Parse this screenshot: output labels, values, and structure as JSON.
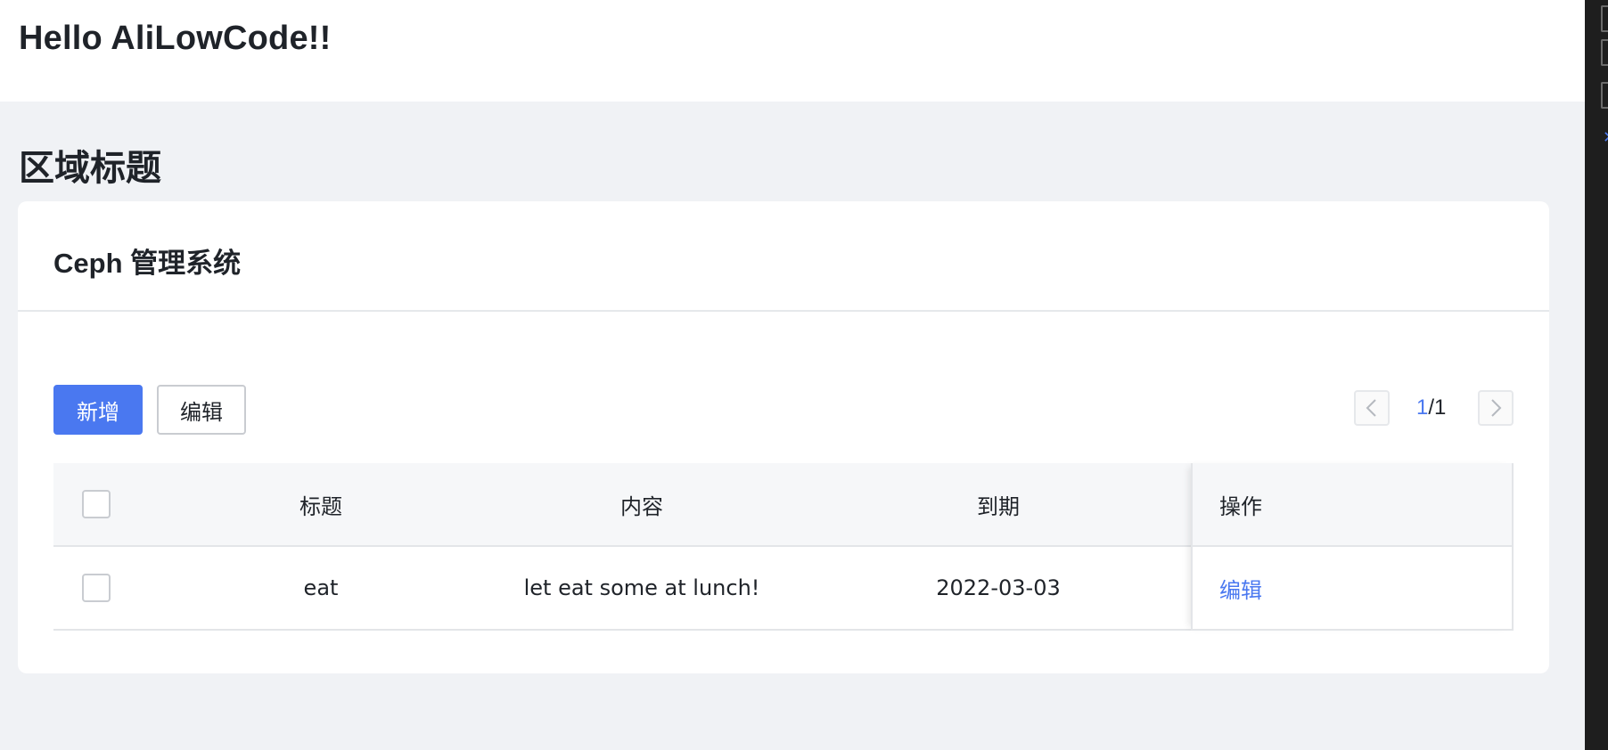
{
  "header": {
    "app_title": "Hello AliLowCode!!"
  },
  "section": {
    "title": "区域标题"
  },
  "card": {
    "title": "Ceph 管理系统",
    "toolbar": {
      "add_label": "新增",
      "edit_label": "编辑"
    },
    "pagination": {
      "current": "1",
      "separator": "/",
      "total": "1"
    },
    "table": {
      "columns": [
        "标题",
        "内容",
        "到期",
        "操作"
      ],
      "rows": [
        {
          "title": "eat",
          "content": "let eat some at lunch!",
          "due": "2022-03-03",
          "action": "编辑"
        }
      ]
    }
  },
  "colors": {
    "primary": "#4a78f0",
    "background": "#f0f2f5",
    "header_bg": "#f6f7f9"
  },
  "icons": {
    "prev": "chevron-left-icon",
    "next": "chevron-right-icon"
  }
}
